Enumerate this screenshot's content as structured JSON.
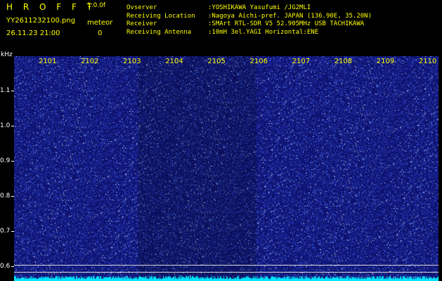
{
  "header": {
    "app_title": "H R O F F T",
    "app_version": "1.0.0f",
    "filename": "YY2611232100.png",
    "datetime": "26.11.23 21:00",
    "meteor_label": "meteor",
    "meteor_count": "0"
  },
  "info": [
    {
      "key": "Ovserver",
      "value": ":YOSHIKAWA Yasufumi /JG2MLI"
    },
    {
      "key": "Receiving Location",
      "value": ":Nagoya Aichi-pref. JAPAN (136.90E, 35.20N)"
    },
    {
      "key": "Receiver",
      "value": ":SMArt RTL-SDR V5 52.905MHz USB TACHIKAWA"
    },
    {
      "key": "Receiving Antenna",
      "value": ":10mH 3el.YAGI Horizontal:ENE"
    }
  ],
  "chart_data": {
    "type": "heatmap",
    "ylabel": "kHz",
    "x_ticks": [
      "2101",
      "2102",
      "2103",
      "2104",
      "2105",
      "2106",
      "2107",
      "2108",
      "2109",
      "2110"
    ],
    "y_ticks": [
      "1.1",
      "1.0",
      "0.9",
      "0.8",
      "0.7",
      "0.6"
    ],
    "ylim": [
      0.57,
      1.2
    ],
    "reference_lines_khz": [
      0.62,
      0.6
    ],
    "colors": {
      "background": "#000000",
      "label_yellow": "#ffff00",
      "spectro_base": "#14147a",
      "noise_floor": "#00e5ff"
    }
  }
}
